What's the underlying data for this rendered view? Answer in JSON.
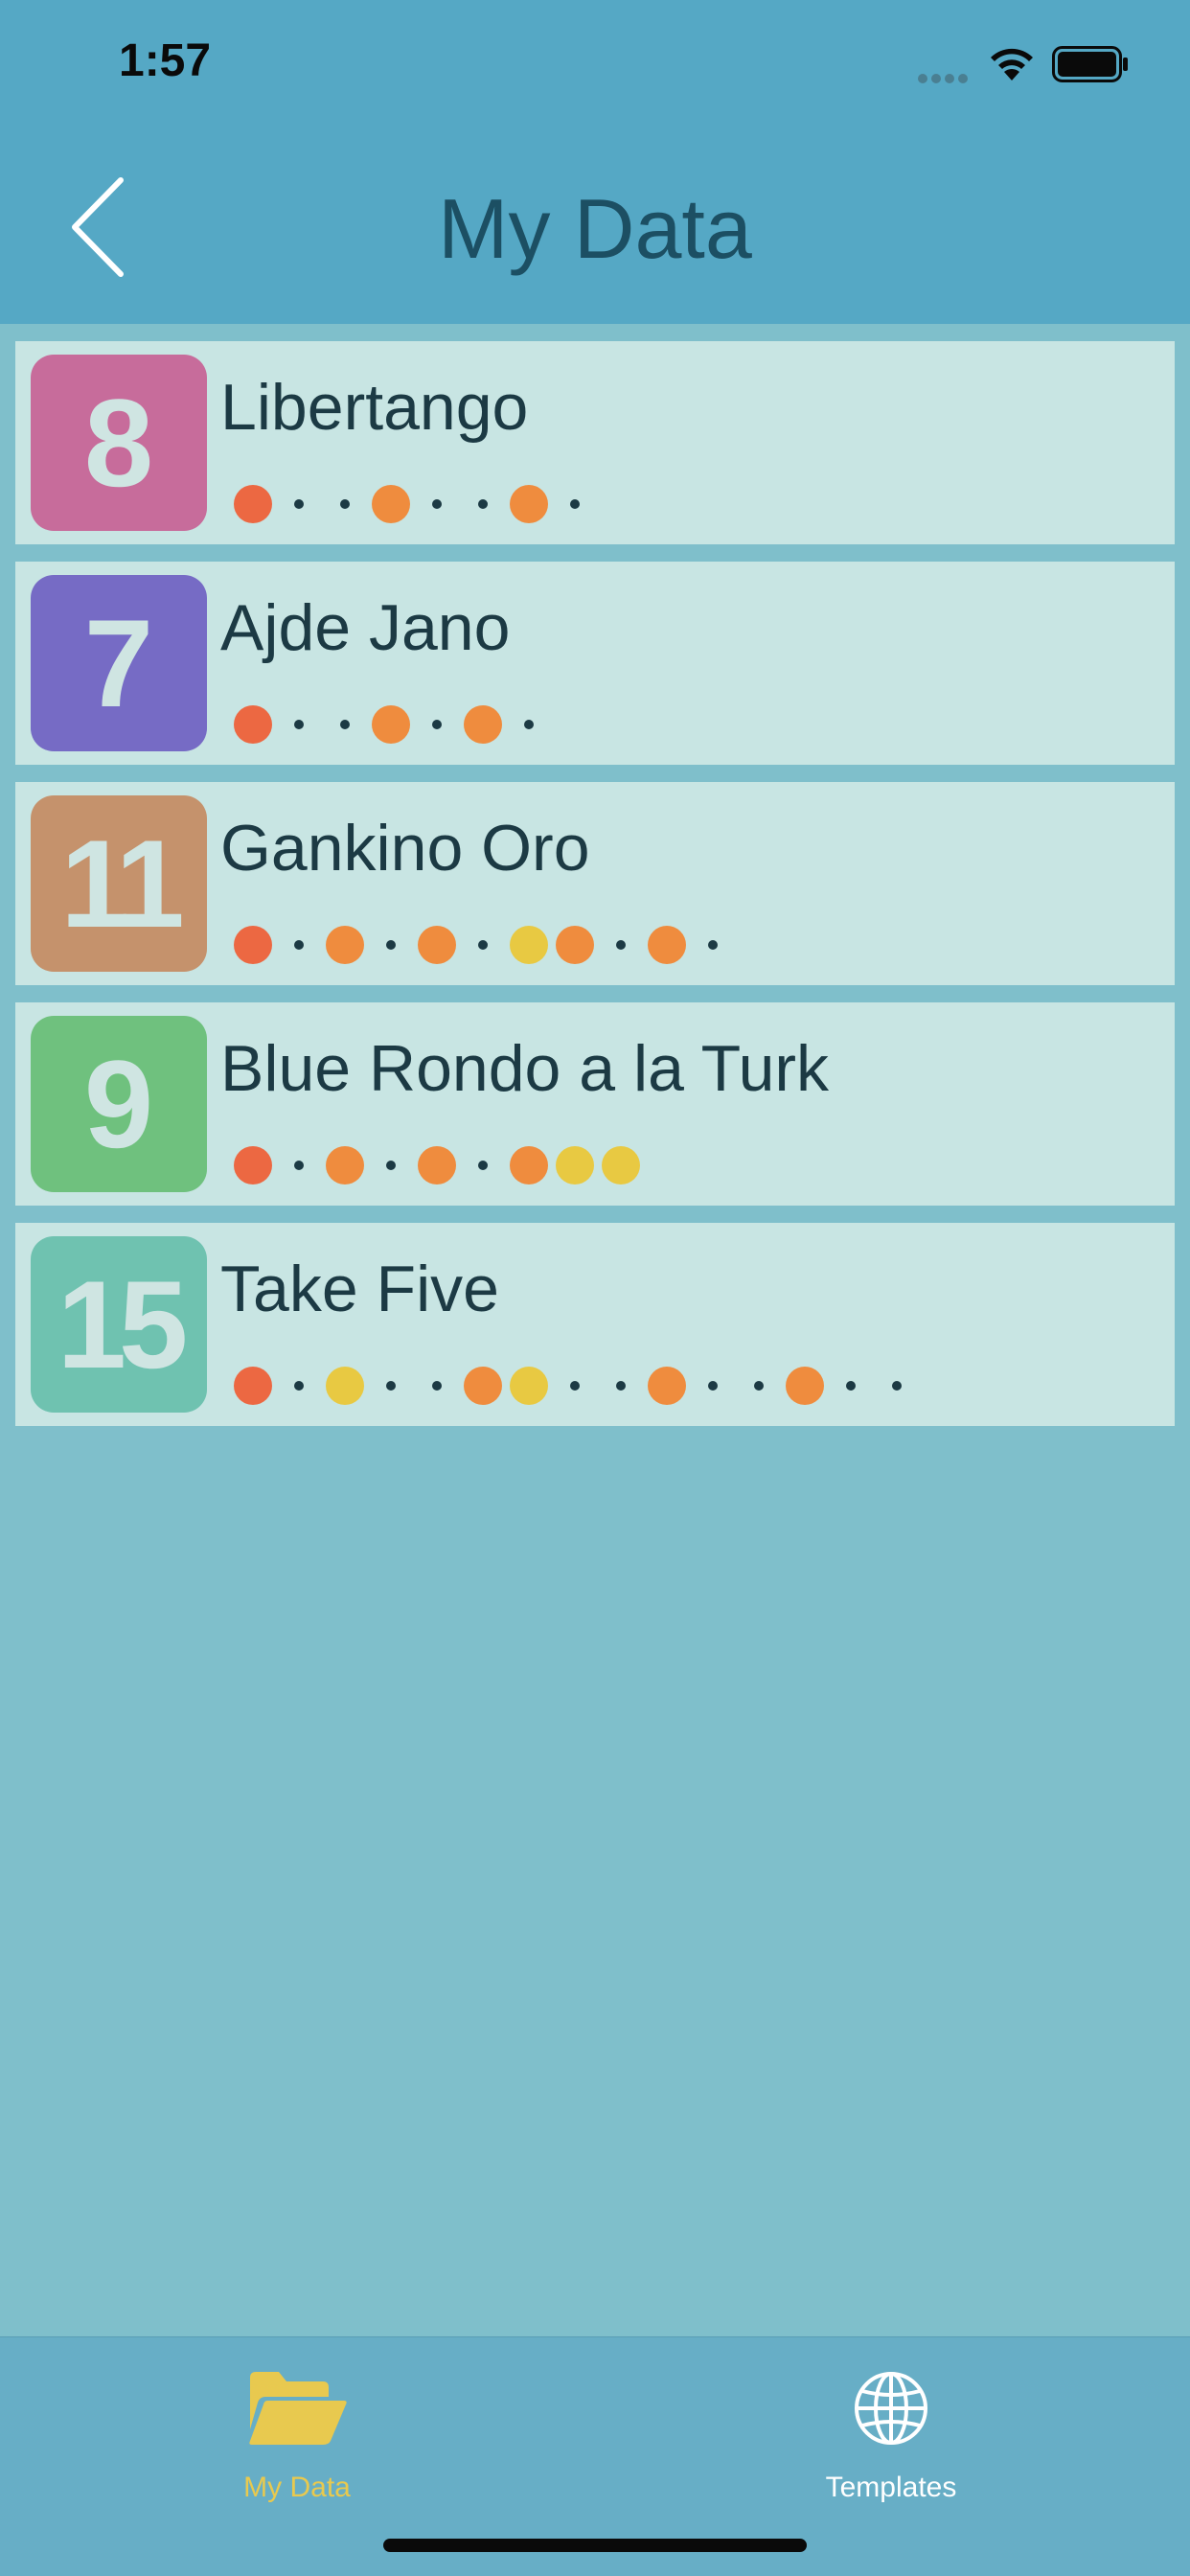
{
  "status": {
    "time": "1:57"
  },
  "nav": {
    "title": "My Data",
    "back_icon": "chevron-left-icon"
  },
  "colors": {
    "beat_red": "#ec6842",
    "beat_orange": "#ef8c3e",
    "beat_yellow": "#e8c942",
    "rest_dot": "#1c3a44",
    "tab_active": "#e8c94f",
    "tab_inactive": "#ffffff"
  },
  "items": [
    {
      "count": "8",
      "title": "Libertango",
      "badge_color": "#c76c9b",
      "pattern": "R..O..O."
    },
    {
      "count": "7",
      "title": "Ajde Jano",
      "badge_color": "#766bc5",
      "pattern": "R..O.O."
    },
    {
      "count": "11",
      "title": "Gankino Oro",
      "badge_color": "#c5926c",
      "pattern": "R.O.O.YO.O."
    },
    {
      "count": "9",
      "title": "Blue Rondo a la Turk",
      "badge_color": "#6fc17e",
      "pattern": "R.O.O.OYY"
    },
    {
      "count": "15",
      "title": "Take Five",
      "badge_color": "#6fc2b0",
      "pattern": "R.Y..OY..O..O.."
    }
  ],
  "tabs": [
    {
      "label": "My Data",
      "icon": "folder-icon",
      "active": true
    },
    {
      "label": "Templates",
      "icon": "globe-icon",
      "active": false
    }
  ]
}
